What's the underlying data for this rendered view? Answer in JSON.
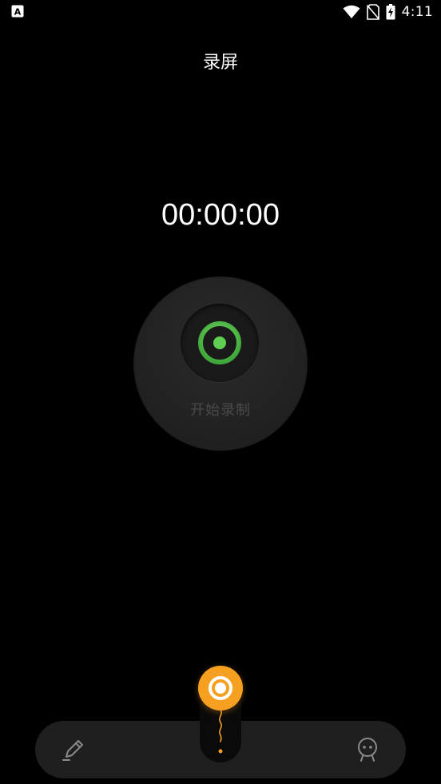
{
  "status_bar": {
    "left_icon": "app-a-icon",
    "icons": [
      "wifi-icon",
      "no-sim-icon",
      "battery-charging-icon"
    ],
    "time": "4:11"
  },
  "page": {
    "title": "录屏"
  },
  "timer": {
    "value": "00:00:00"
  },
  "record_button": {
    "label": "开始录制",
    "icon": "record-target-icon",
    "accent_color": "#5fcf52"
  },
  "bottom_nav": {
    "left_icon": "pen-edit-icon",
    "center_icon": "record-ring-icon",
    "right_icon": "robot-face-icon",
    "center_color": "#f5a020"
  }
}
